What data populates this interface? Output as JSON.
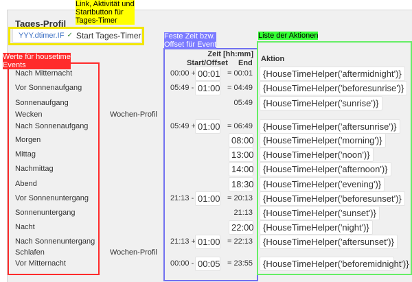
{
  "panel": {
    "title": "Tages-Profil"
  },
  "timer": {
    "link": "YYY.dtimer.IF",
    "check": "✓",
    "button": "Start Tages-Timer"
  },
  "headers": {
    "zeit": "Zeit [hh:mm]",
    "start_offset": "Start/Offset",
    "end": "End",
    "action": "Aktion"
  },
  "rows": [
    {
      "event": "Nach Mitternacht",
      "start": "00:00 +",
      "offset": "00:01",
      "end": "= 00:01",
      "action": "{HouseTimeHelper('aftermidnight')}"
    },
    {
      "event": "Vor Sonnenaufgang",
      "start": "05:49 -",
      "offset": "01:00",
      "end": "= 04:49",
      "action": "{HouseTimeHelper('beforesunrise')}"
    },
    {
      "event": "Sonnenaufgang",
      "end": "05:49",
      "action": "{HouseTimeHelper('sunrise')}"
    },
    {
      "event": "Wecken",
      "profile": "Wochen-Profil"
    },
    {
      "event": "Nach Sonnenaufgang",
      "start": "05:49 +",
      "offset": "01:00",
      "end": "= 06:49",
      "action": "{HouseTimeHelper('aftersunrise')}"
    },
    {
      "event": "Morgen",
      "end_field": "08:00",
      "action": "{HouseTimeHelper('morning')}"
    },
    {
      "event": "Mittag",
      "end_field": "13:00",
      "action": "{HouseTimeHelper('noon')}"
    },
    {
      "event": "Nachmittag",
      "end_field": "14:00",
      "action": "{HouseTimeHelper('afternoon')}"
    },
    {
      "event": "Abend",
      "end_field": "18:30",
      "action": "{HouseTimeHelper('evening')}"
    },
    {
      "event": "Vor Sonnenuntergang",
      "start": "21:13 -",
      "offset": "01:00",
      "end": "= 20:13",
      "action": "{HouseTimeHelper('beforesunset')}"
    },
    {
      "event": "Sonnenuntergang",
      "end": "21:13",
      "action": "{HouseTimeHelper('sunset')}"
    },
    {
      "event": "Nacht",
      "end_field": "22:00",
      "action": "{HouseTimeHelper('night')}"
    },
    {
      "event": "Nach Sonnenuntergang",
      "start": "21:13 +",
      "offset": "01:00",
      "end": "= 22:13",
      "action": "{HouseTimeHelper('aftersunset')}"
    },
    {
      "event": "Schlafen",
      "profile": "Wochen-Profil"
    },
    {
      "event": "Vor Mitternacht",
      "start": "00:00 -",
      "offset": "00:05",
      "end": "= 23:55",
      "action": "{HouseTimeHelper('beforemidnight')}"
    }
  ],
  "annotations": {
    "link": "Link, Aktivität und\nStartbutton für\nTages-Timer",
    "events": "Werte für housetime\nEvents",
    "fixed_time": "Feste Zeit bzw.\nOffset für Event",
    "actions": "Liste der Aktionen"
  },
  "colors": {
    "yellow": "#ffff00",
    "yellow_border": "#f2e600",
    "red": "#ff2b2b",
    "blue": "#7b7bff",
    "blue_border": "#7070f0",
    "green": "#33ff33",
    "green_border": "#66ee66"
  }
}
